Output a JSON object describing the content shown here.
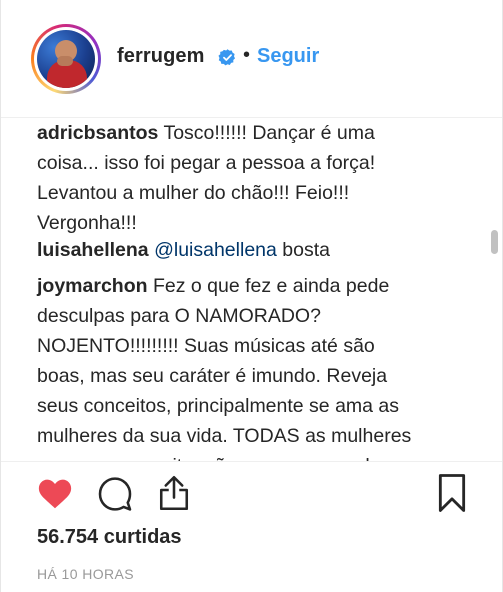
{
  "header": {
    "username": "ferrugem",
    "separator": "•",
    "follow_label": "Seguir"
  },
  "comments": [
    {
      "user": "adricbsantos",
      "lines": [
        "Tosco!!!!!! Dançar é uma",
        "coisa... isso foi pegar a pessoa a força!",
        "Levantou a mulher do chão!!! Feio!!!",
        "Vergonha!!!"
      ]
    },
    {
      "user": "luisahellena",
      "mention": "@luisahellena",
      "text": "bosta"
    },
    {
      "user": "joymarchon",
      "lines": [
        "Fez o que fez e ainda pede",
        "desculpas para O NAMORADO?",
        "NOJENTO!!!!!!!!! Suas músicas até são",
        "boas, mas seu caráter é imundo. Reveja",
        "seus conceitos, principalmente se ama as",
        "mulheres da sua vida. TODAS as mulheres",
        "merecem respeito, não somos um pedaço"
      ]
    }
  ],
  "actions": {
    "like_icon": "heart-filled-red",
    "comment_icon": "speech-bubble-outline",
    "share_icon": "share-upload-outline",
    "save_icon": "bookmark-outline"
  },
  "likes_text": "56.754 curtidas",
  "timestamp": "HÁ 10 HORAS",
  "colors": {
    "accent": "#3897f0",
    "like": "#ed4956",
    "text": "#262626",
    "muted": "#999999",
    "mention": "#003569"
  }
}
